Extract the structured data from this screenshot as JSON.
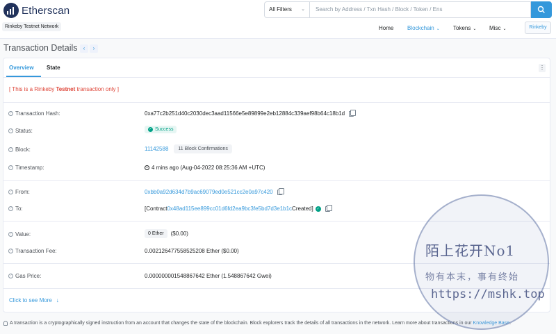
{
  "header": {
    "brand": "Etherscan",
    "network": "Rinkeby Testnet Network",
    "filter": "All Filters",
    "search_placeholder": "Search by Address / Txn Hash / Block / Token / Ens",
    "nav": {
      "home": "Home",
      "blockchain": "Blockchain",
      "tokens": "Tokens",
      "misc": "Misc",
      "network_button": "Rinkeby"
    }
  },
  "page": {
    "title": "Transaction Details"
  },
  "tabs": {
    "overview": "Overview",
    "state": "State"
  },
  "notice": {
    "prefix": "[ This is a Rinkeby ",
    "bold": "Testnet",
    "suffix": " transaction only ]"
  },
  "details": {
    "hash": {
      "label": "Transaction Hash:",
      "value": "0xa77c2b251d40c2030dec3aad11566e5e89899e2eb12884c339aef98b64c18b1d"
    },
    "status": {
      "label": "Status:",
      "value": "Success"
    },
    "block": {
      "label": "Block:",
      "value": "11142588",
      "confirmations": "11 Block Confirmations"
    },
    "timestamp": {
      "label": "Timestamp:",
      "value": "4 mins ago (Aug-04-2022 08:25:36 AM +UTC)"
    },
    "from": {
      "label": "From:",
      "value": "0xbb0a92d634d7b9ac69079ed0e521cc2e0a97c420"
    },
    "to": {
      "label": "To:",
      "prefix": "[Contract ",
      "address": "0x48ad115ee899cc01d6fd2ea9bc3fe5bd7d3e1b1c",
      "suffix": " Created]"
    },
    "value": {
      "label": "Value:",
      "amount": "0 Ether",
      "usd": "($0.00)"
    },
    "fee": {
      "label": "Transaction Fee:",
      "value": "0.002126477558525208 Ether ($0.00)"
    },
    "gas": {
      "label": "Gas Price:",
      "value": "0.000000001548867642 Ether (1.548867642 Gwei)"
    }
  },
  "see_more": "Click to see More",
  "footnote": {
    "text": "A transaction is a cryptographically signed instruction from an account that changes the state of the blockchain. Block explorers track the details of all transactions in the network. Learn more about transactions in our ",
    "link": "Knowledge Base",
    "end": "."
  },
  "watermark": {
    "line1": "陌上花开No1",
    "line2": "物有本末，事有终始",
    "line3": "https://mshk.top"
  },
  "colors": {
    "accent": "#3498db",
    "success": "#00a186",
    "danger": "#de4437",
    "brand": "#21325b"
  }
}
